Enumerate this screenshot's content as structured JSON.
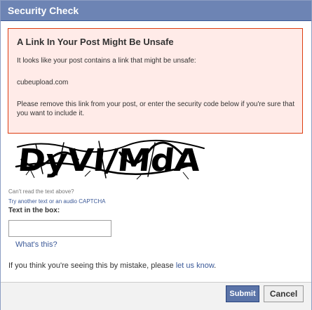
{
  "dialog": {
    "title": "Security Check"
  },
  "warning": {
    "heading": "A Link In Your Post Might Be Unsafe",
    "line1": "It looks like your post contains a link that might be unsafe:",
    "link": "cubeupload.com",
    "line2": "Please remove this link from your post, or enter the security code below if you're sure that you want to include it."
  },
  "captcha": {
    "image_text": "DyVI/MdA",
    "cant_read": "Can't read the text above?",
    "try_another": "Try another text",
    "or_text": " or ",
    "audio_captcha": "an audio CAPTCHA"
  },
  "form": {
    "label": "Text in the box:",
    "value": "",
    "whats_this": "What's this?"
  },
  "mistake": {
    "prefix": "If you think you're seeing this by mistake, please ",
    "link": "let us know",
    "suffix": "."
  },
  "buttons": {
    "submit": "Submit",
    "cancel": "Cancel"
  },
  "colors": {
    "titlebar": "#6d84b4",
    "link": "#3b5998",
    "warning_bg": "#ffebe8",
    "warning_border": "#dd3c10",
    "submit_bg": "#5b74a8"
  }
}
